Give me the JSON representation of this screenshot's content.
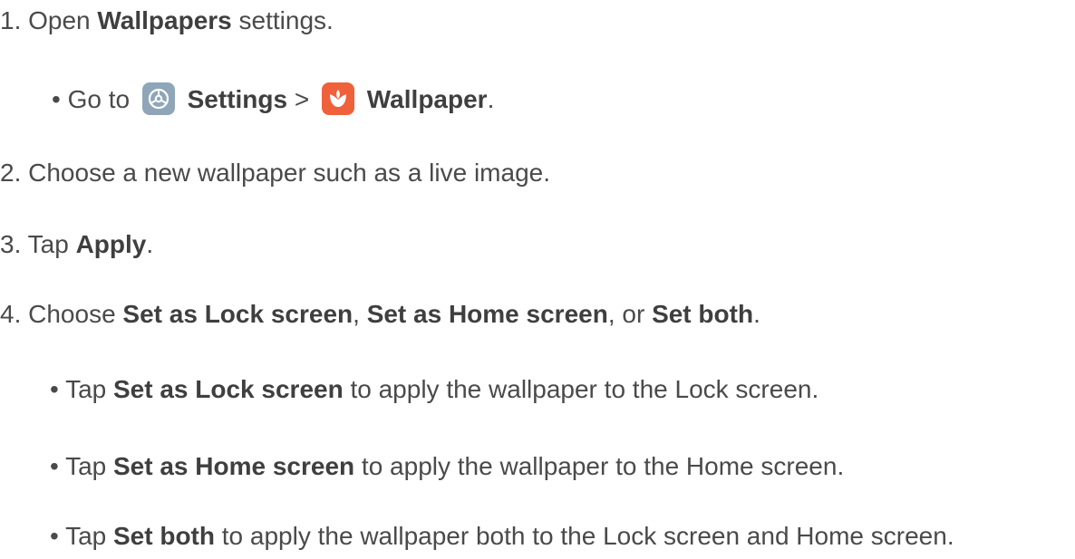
{
  "colors": {
    "text": "#4a4a4a",
    "settings_icon_bg": "#8fa6b8",
    "wallpaper_icon_bg": "#f0603a"
  },
  "step1": {
    "prefix": "1. Open ",
    "bold": "Wallpapers",
    "suffix": " settings.",
    "sub": {
      "prefix": "• Go to ",
      "settings_icon": "settings-gear-icon",
      "settings_label": "Settings",
      "separator": " > ",
      "wallpaper_icon": "wallpaper-flower-icon",
      "wallpaper_label": "Wallpaper",
      "end": "."
    }
  },
  "step2": {
    "text": "2. Choose a new wallpaper such as a live image."
  },
  "step3": {
    "prefix": "3. Tap ",
    "bold": "Apply",
    "suffix": "."
  },
  "step4": {
    "prefix": "4. Choose ",
    "bold1": "Set as Lock screen",
    "sep1": ", ",
    "bold2": "Set as Home screen",
    "sep2": ", or ",
    "bold3": "Set both",
    "suffix": ".",
    "bullets": [
      {
        "prefix": "• Tap ",
        "bold": "Set as Lock screen",
        "suffix": " to apply the wallpaper to the Lock screen."
      },
      {
        "prefix": "• Tap ",
        "bold": "Set as Home screen",
        "suffix": " to apply the wallpaper to the Home screen."
      },
      {
        "prefix": "• Tap ",
        "bold": "Set both",
        "suffix": " to apply the wallpaper both to the Lock screen and Home screen."
      }
    ]
  }
}
